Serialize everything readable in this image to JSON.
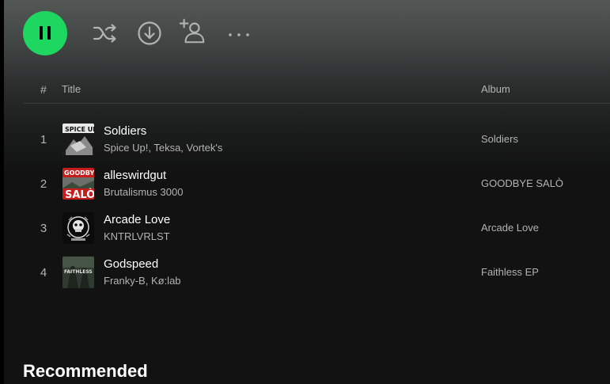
{
  "player": {
    "play_state": "playing",
    "accent_color": "#1ed760",
    "icons": {
      "play_pause": "pause-icon",
      "shuffle": "shuffle-icon",
      "download": "download-icon",
      "invite": "add-user-icon",
      "more": "more-options-icon"
    }
  },
  "tracklist": {
    "columns": {
      "number": "#",
      "title": "Title",
      "album": "Album"
    },
    "tracks": [
      {
        "number": "1",
        "title": "Soldiers",
        "artists": "Spice Up!, Teksa, Vortek's",
        "album": "Soldiers",
        "cover_text": "SPICE UP!"
      },
      {
        "number": "2",
        "title": "alleswirdgut",
        "artists": "Brutalismus 3000",
        "album": "GOODBYE SALÒ",
        "cover_text": "GOODBYE SALÒ"
      },
      {
        "number": "3",
        "title": "Arcade Love",
        "artists": "KNTRLVRLST",
        "album": "Arcade Love"
      },
      {
        "number": "4",
        "title": "Godspeed",
        "artists": "Franky-B, Kø:lab",
        "album": "Faithless EP",
        "cover_text": "FAITHLESS"
      }
    ]
  },
  "sections": {
    "recommended": "Recommended"
  }
}
